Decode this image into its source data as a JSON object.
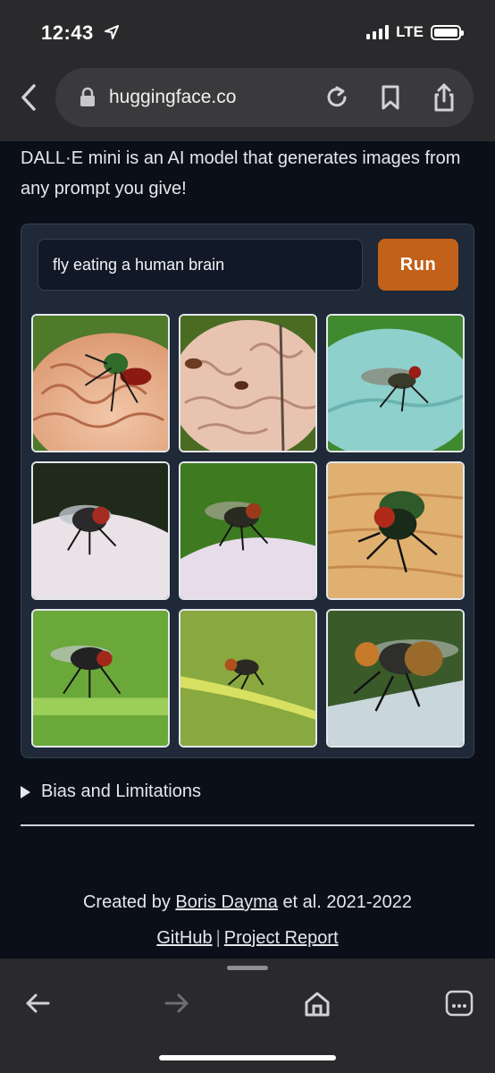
{
  "status": {
    "time": "12:43",
    "network": "LTE"
  },
  "browser": {
    "url": "huggingface.co"
  },
  "page": {
    "intro": "DALL·E mini is an AI model that generates images from any prompt you give!",
    "prompt_value": "fly eating a human brain",
    "run_label": "Run",
    "images": [
      "fly-on-brain-1",
      "fly-on-brain-2",
      "fly-on-blue-leaf",
      "fly-on-petal-1",
      "fly-on-petal-2",
      "fly-on-wood",
      "fly-on-stem",
      "fly-on-yellow-stem",
      "fly-closeup"
    ],
    "bias_label": "Bias and Limitations",
    "footer": {
      "created_by": "Created by",
      "author": "Boris Dayma",
      "suffix": "et al. 2021-2022",
      "github": "GitHub",
      "separator": "|",
      "report": "Project Report"
    }
  },
  "icons": {
    "back": "back-chevron-icon",
    "lock": "lock-icon",
    "reload": "reload-icon",
    "bookmark": "bookmark-icon",
    "share": "share-icon",
    "nav_back": "arrow-left-icon",
    "nav_forward": "arrow-right-icon",
    "home": "home-icon",
    "more": "more-icon"
  },
  "colors": {
    "page_bg": "#0b0f19",
    "panel_bg": "#1f2937",
    "run_button": "#c2611a",
    "chrome_bg": "#2a2a2c"
  }
}
